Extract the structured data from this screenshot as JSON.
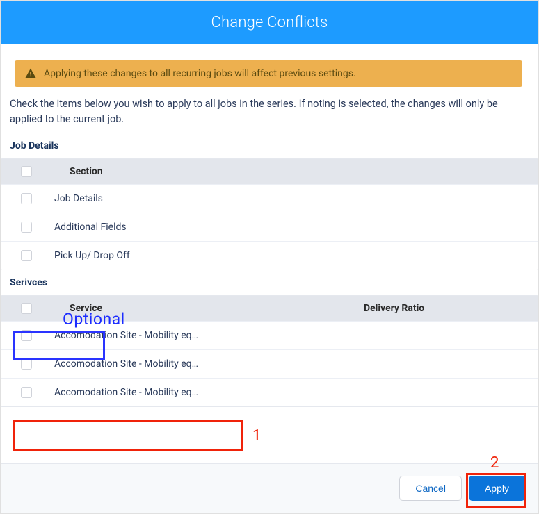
{
  "header": {
    "title": "Change Conflicts"
  },
  "warning": {
    "icon": "warning-triangle",
    "text": "Applying these changes to all recurring jobs will affect previous settings."
  },
  "intro": "Check the items below you wish to apply to all jobs in the series. If noting is selected, the changes will only be applied to the current job.",
  "jobDetails": {
    "label": "Job Details",
    "header": "Section",
    "rows": [
      {
        "label": "Job Details"
      },
      {
        "label": "Additional Fields"
      },
      {
        "label": "Pick Up/ Drop Off"
      }
    ]
  },
  "services": {
    "label": "Serivces",
    "header": {
      "service": "Service",
      "ratio": "Delivery Ratio"
    },
    "rows": [
      {
        "label": "Accomodation Site - Mobility eq…"
      },
      {
        "label": "Accomodation Site - Mobility eq…"
      },
      {
        "label": "Accomodation Site - Mobility eq…"
      }
    ]
  },
  "footer": {
    "cancel": "Cancel",
    "apply": "Apply"
  },
  "annotations": {
    "optional": "Optional",
    "one": "1",
    "two": "2"
  }
}
